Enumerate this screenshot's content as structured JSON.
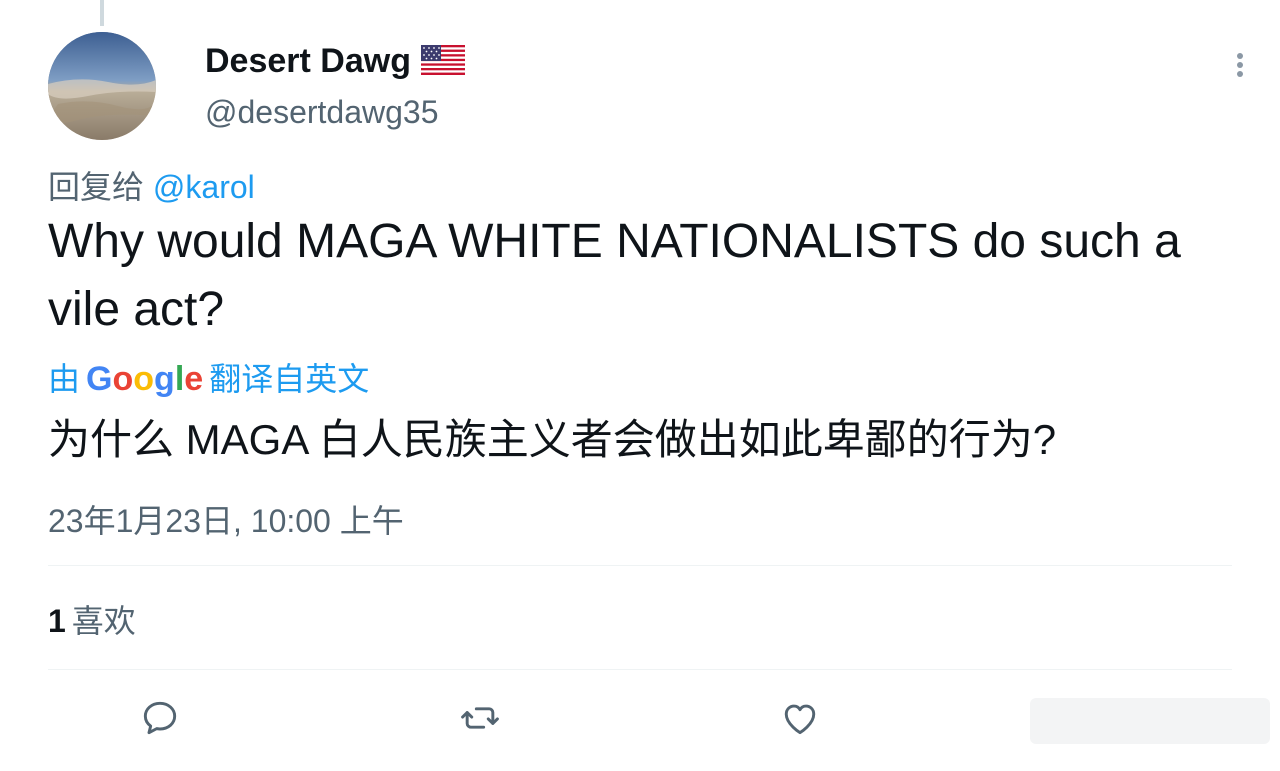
{
  "tweet": {
    "author": {
      "display_name": "Desert Dawg",
      "flag_icon": "us-flag-icon",
      "handle": "@desertdawg35"
    },
    "reply_to": {
      "prefix": "回复给",
      "mention": "@karol"
    },
    "text": "Why would MAGA WHITE NATIONALISTS do such a vile act?",
    "translation": {
      "by_label": "由",
      "google_label": "Google",
      "suffix_label": "翻译自英文",
      "text": "为什么 MAGA 白人民族主义者会做出如此卑鄙的行为?"
    },
    "timestamp": "23年1月23日, 10:00 上午",
    "stats": {
      "likes_count": "1",
      "likes_label": "喜欢"
    },
    "actions": [
      "reply-icon",
      "retweet-icon",
      "like-icon"
    ]
  },
  "colors": {
    "text_primary": "#0f1419",
    "text_secondary": "#536471",
    "accent": "#1d9bf0",
    "divider": "#eff3f4"
  }
}
